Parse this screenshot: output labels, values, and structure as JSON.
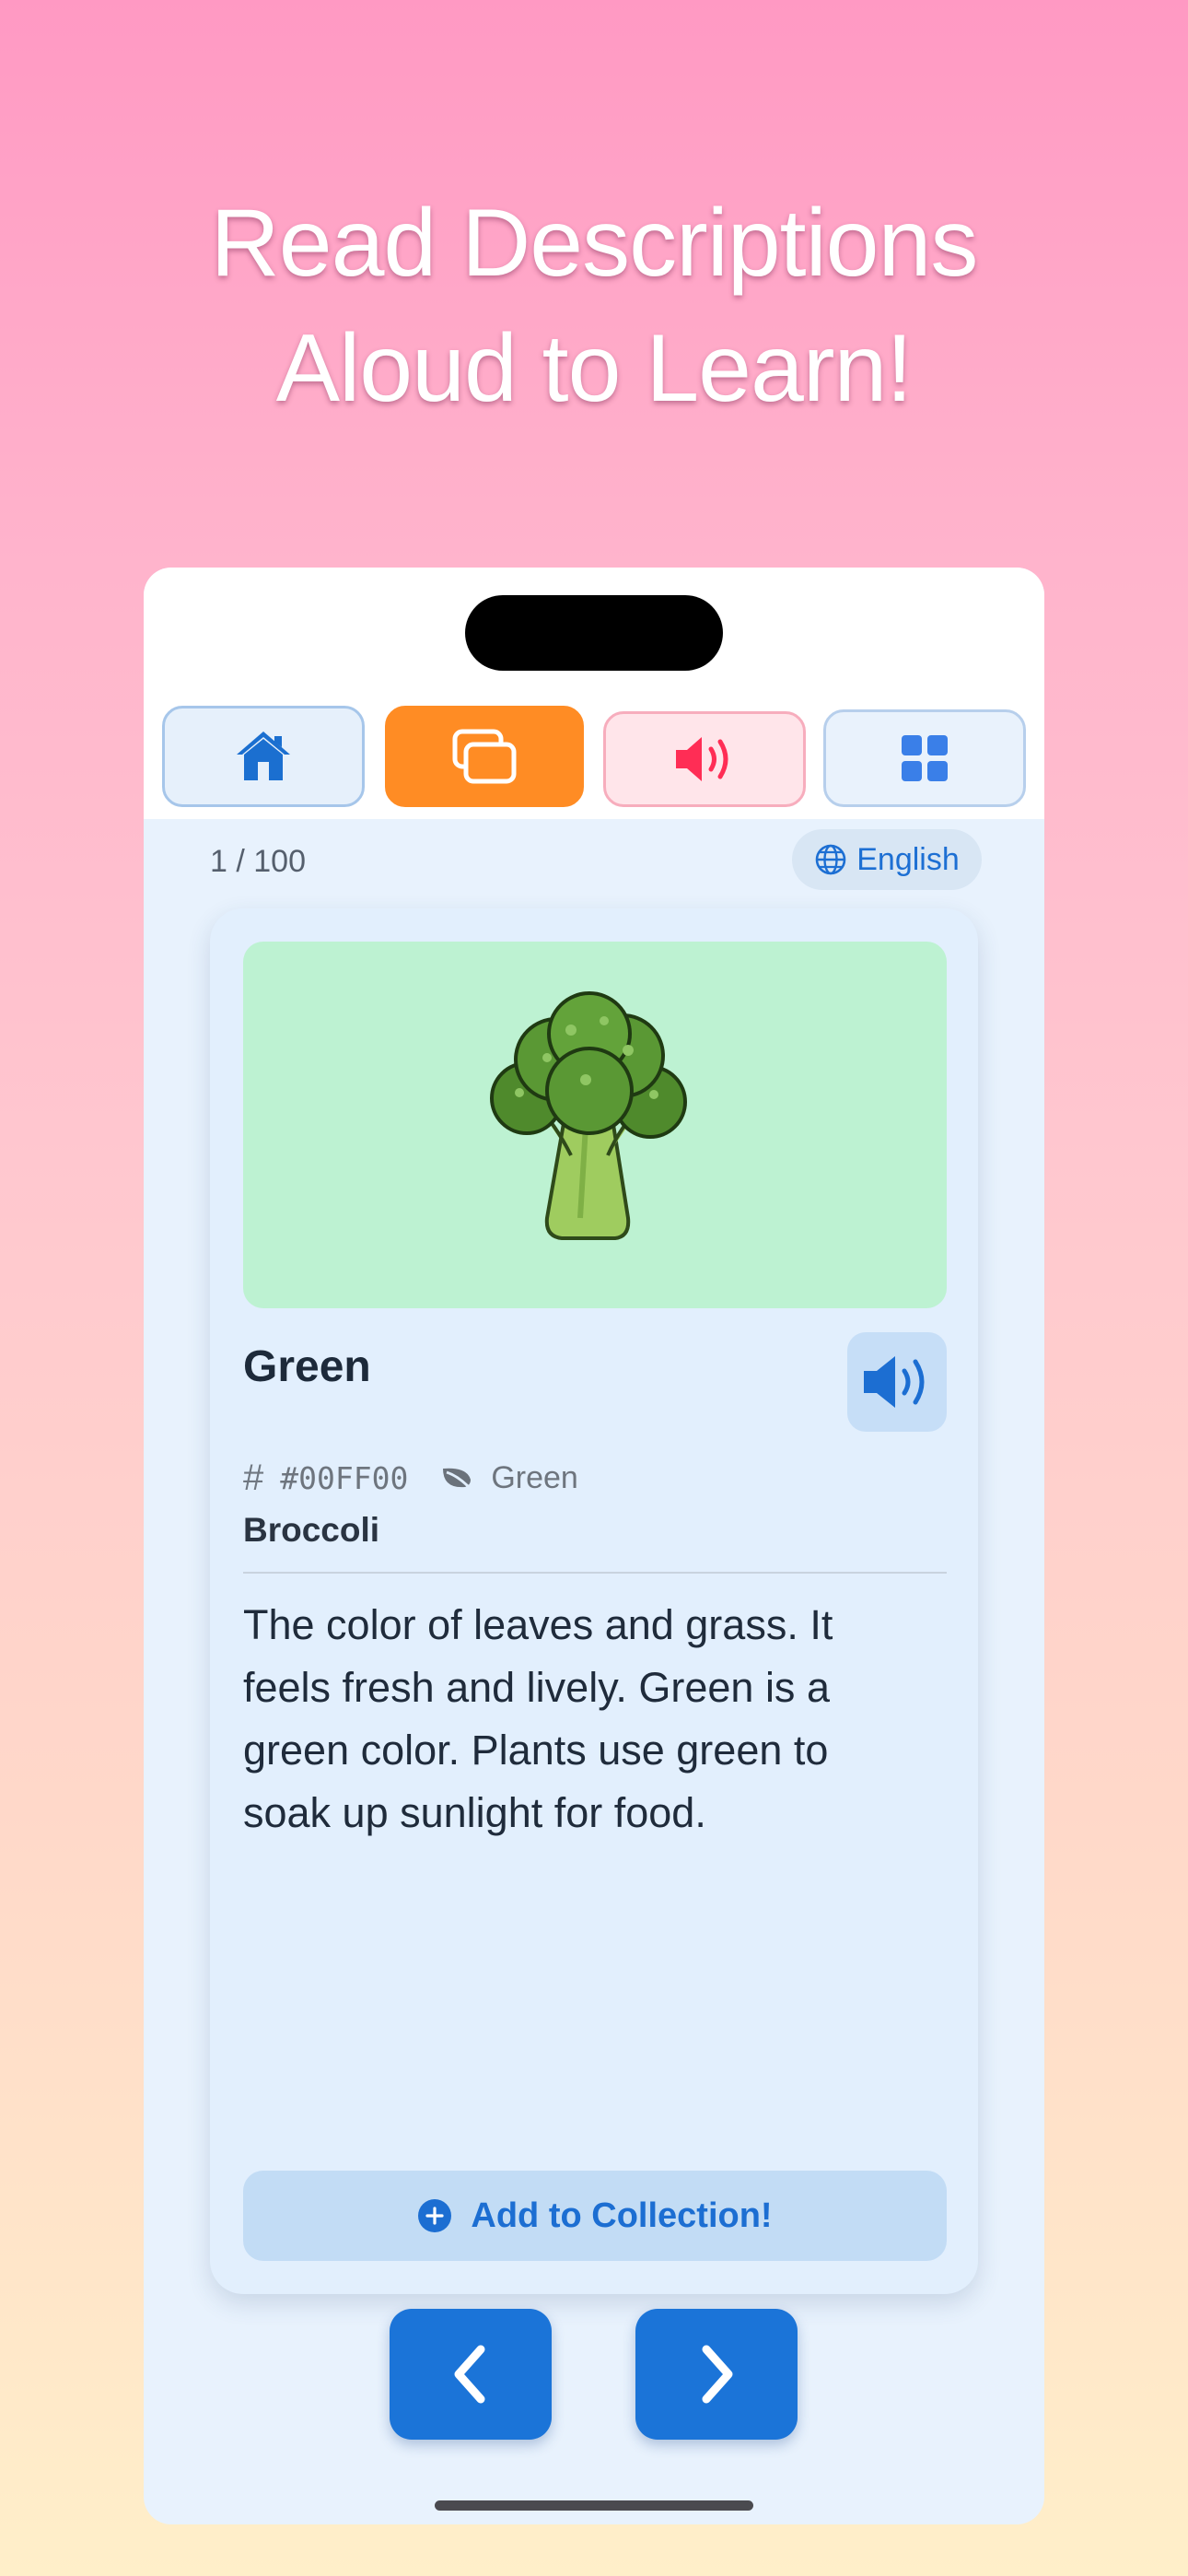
{
  "headline": {
    "line1": "Read Descriptions",
    "line2": "Aloud to Learn!"
  },
  "tabbar": {
    "tabs": [
      {
        "id": "home",
        "icon": "house-icon",
        "selected": false
      },
      {
        "id": "cards",
        "icon": "cards-icon",
        "selected": true
      },
      {
        "id": "audio",
        "icon": "speaker-icon",
        "selected": false
      },
      {
        "id": "grid",
        "icon": "grid-icon",
        "selected": false
      }
    ]
  },
  "status": {
    "progress": "1 / 100",
    "language": "English",
    "language_icon": "globe-icon"
  },
  "card": {
    "illustration": "broccoli-illustration",
    "title": "Green",
    "hex_symbol": "#",
    "hex_value": "#00FF00",
    "family_icon": "leaf-icon",
    "family": "Green",
    "object": "Broccoli",
    "description": "The color of leaves and grass. It feels fresh and lively. Green is a green color. Plants use green to soak up sunlight for food.",
    "add_button_label": "Add to Collection!",
    "speak_icon": "speaker-icon"
  },
  "navigation": {
    "prev_icon": "chevron-left-icon",
    "next_icon": "chevron-right-icon"
  },
  "colors": {
    "accent_blue": "#1b74d8",
    "accent_orange": "#ff8c24",
    "audio_pink": "#ff2d55",
    "swatch_green": "#bdf2d2",
    "card_background": "#e2effd"
  }
}
